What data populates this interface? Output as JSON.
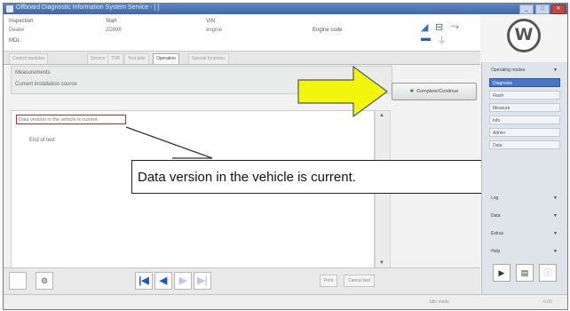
{
  "window": {
    "title": "Offboard Diagnostic Information System Service - [ ]",
    "controls": [
      "_",
      "□",
      "✕"
    ]
  },
  "vehicle_info": {
    "fields": [
      {
        "label": "Inspection",
        "value": "Dealer"
      },
      {
        "label": "Start",
        "value": "2D998"
      },
      {
        "label": "VIN",
        "value": "engine"
      },
      {
        "label": "Engine code",
        "value": ""
      }
    ],
    "extra_label": "MDL"
  },
  "tabs": [
    "Control modules",
    "Service",
    "TSB",
    "Test plan",
    "Operation",
    "Special functions"
  ],
  "active_tab": "Operation",
  "panel": {
    "title": "Measurements",
    "subtitle": "Current installation source"
  },
  "content": {
    "highlight_text": "Data version in the vehicle is current.",
    "end_text": "End of test"
  },
  "continue_button": {
    "label": "Complete/Continue",
    "icon": "star-icon"
  },
  "callout_text": "Data version in the vehicle is current.",
  "arrow_color": "#f2f50c",
  "highlight_color": "#d22424",
  "sidebar": {
    "header": "Operating modes",
    "items": [
      {
        "label": "Diagnosis",
        "highlighted": true
      },
      {
        "label": "Flash",
        "highlighted": false
      },
      {
        "label": "Measure",
        "highlighted": false
      },
      {
        "label": "Info",
        "highlighted": false
      },
      {
        "label": "Admin",
        "highlighted": false
      },
      {
        "label": "Data",
        "highlighted": false
      }
    ],
    "sections": [
      "Log",
      "Data",
      "Extras",
      "Help"
    ]
  },
  "bottom_nav": [
    "first-icon",
    "prev-icon",
    "next-icon",
    "last-icon"
  ],
  "bottom_buttons": [
    "Print",
    "Cancel test"
  ],
  "statusbar": {
    "left": "",
    "mid": "Idle mode",
    "right": "0.00"
  }
}
